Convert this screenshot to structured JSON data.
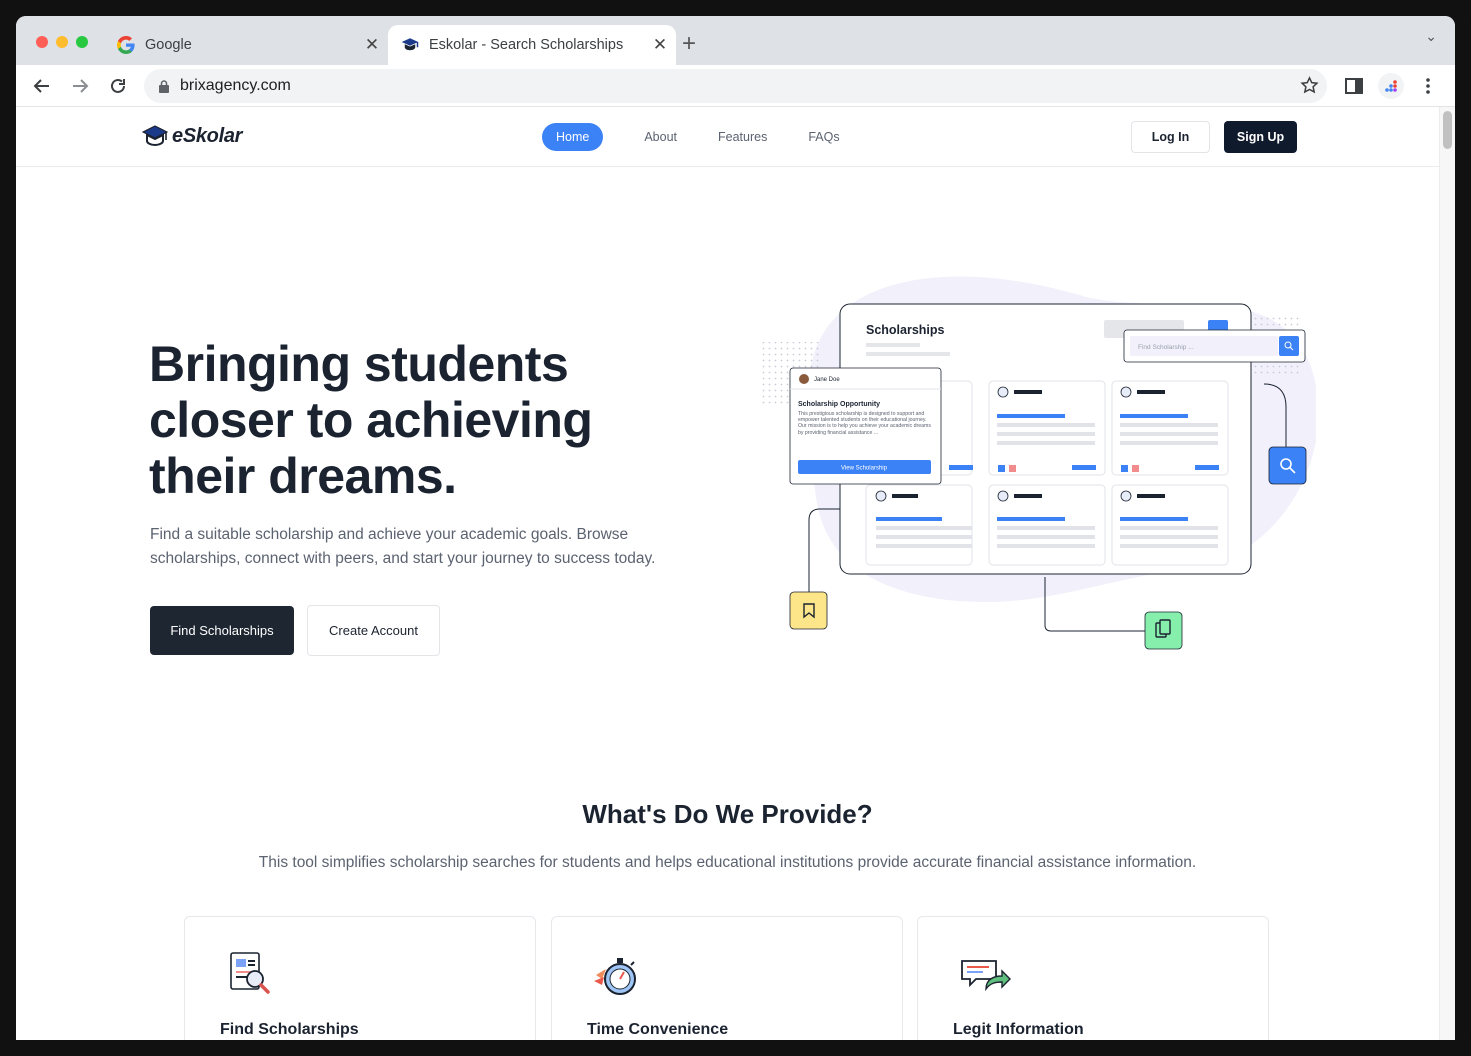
{
  "browser": {
    "tabs": [
      {
        "label": "Google",
        "icon": "google-favicon"
      },
      {
        "label": "Eskolar - Search Scholarships",
        "icon": "graduation-cap-favicon"
      }
    ],
    "url": "brixagency.com"
  },
  "site": {
    "brand": "eSkolar",
    "nav": [
      "Home",
      "About",
      "Features",
      "FAQs"
    ],
    "login": "Log In",
    "signup": "Sign Up"
  },
  "hero": {
    "title_lines": [
      "Bringing students",
      "closer to achieving",
      "their dreams."
    ],
    "subtitle": "Find a suitable scholarship and achieve your academic goals. Browse scholarships, connect with peers, and start your journey to success today.",
    "primary_cta": "Find Scholarships",
    "secondary_cta": "Create Account"
  },
  "illustration": {
    "panel_title": "Scholarships",
    "search_placeholder": "Find Scholarship ...",
    "popup_user": "Jane Doe",
    "popup_title": "Scholarship Opportunity",
    "popup_text": "This prestigious scholarship is designed to support and empower talented students on their educational journey. Our mission is to help you achieve your academic dreams by providing financial assistance ...",
    "popup_button": "View Scholarship"
  },
  "provide": {
    "title": "What's Do We Provide?",
    "subtitle": "This tool simplifies scholarship searches for students and helps educational institutions provide accurate financial assistance information.",
    "cards": [
      {
        "title": "Find Scholarships",
        "icon": "document-search-icon"
      },
      {
        "title": "Time Convenience",
        "icon": "stopwatch-icon"
      },
      {
        "title": "Legit Information",
        "icon": "chat-share-icon"
      }
    ]
  },
  "colors": {
    "accent": "#3b82f6",
    "dark": "#1e2631",
    "text": "#1b2330",
    "muted": "#5b6270"
  }
}
